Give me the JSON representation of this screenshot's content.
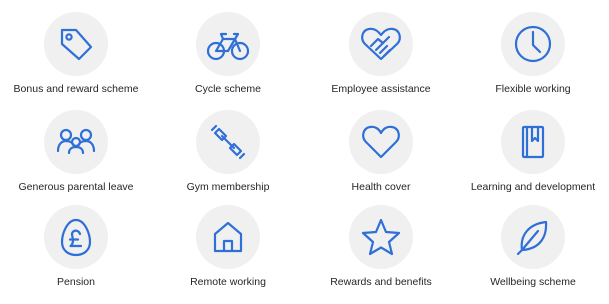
{
  "colors": {
    "icon_stroke": "#2f6fd8",
    "icon_circle": "#f0f0f0",
    "label_text": "#262626",
    "background": "#ffffff"
  },
  "benefits": [
    {
      "label": "Bonus and reward scheme",
      "icon": "price-tag-icon"
    },
    {
      "label": "Cycle scheme",
      "icon": "bicycle-icon"
    },
    {
      "label": "Employee assistance",
      "icon": "handshake-heart-icon"
    },
    {
      "label": "Flexible working",
      "icon": "clock-icon"
    },
    {
      "label": "Generous parental leave",
      "icon": "family-icon"
    },
    {
      "label": "Gym membership",
      "icon": "dumbbell-icon"
    },
    {
      "label": "Health cover",
      "icon": "heart-icon"
    },
    {
      "label": "Learning and development",
      "icon": "book-icon"
    },
    {
      "label": "Pension",
      "icon": "pound-egg-icon"
    },
    {
      "label": "Remote working",
      "icon": "home-icon"
    },
    {
      "label": "Rewards and benefits",
      "icon": "star-icon"
    },
    {
      "label": "Wellbeing scheme",
      "icon": "leaf-icon"
    }
  ]
}
